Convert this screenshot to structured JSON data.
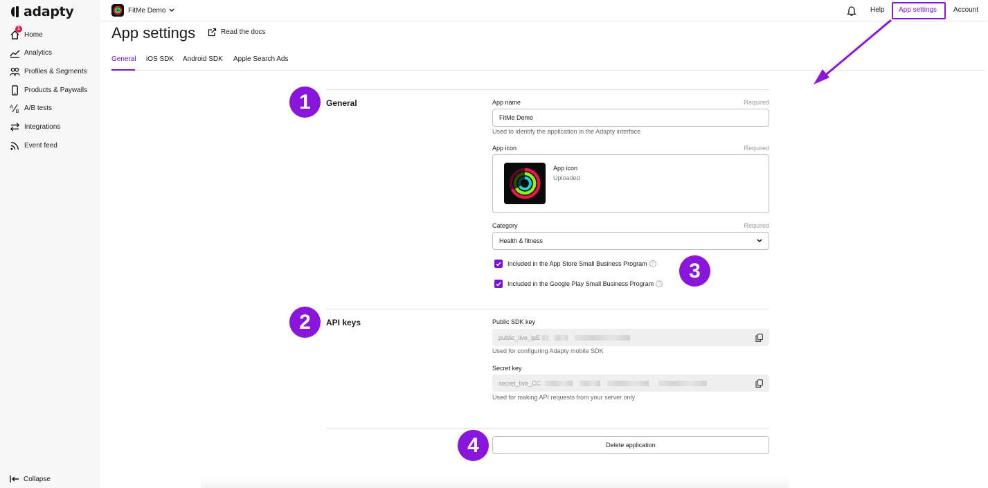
{
  "brand": {
    "name": "adapty",
    "accent": "#8a16dc"
  },
  "sidebar": {
    "items": [
      {
        "label": "Home",
        "icon": "home-icon",
        "badge": "1"
      },
      {
        "label": "Analytics",
        "icon": "chart-line-icon"
      },
      {
        "label": "Profiles & Segments",
        "icon": "users-icon"
      },
      {
        "label": "Products & Paywalls",
        "icon": "phone-icon"
      },
      {
        "label": "A/B tests",
        "icon": "ab-test-icon"
      },
      {
        "label": "Integrations",
        "icon": "arrows-exchange-icon"
      },
      {
        "label": "Event feed",
        "icon": "rss-icon"
      }
    ],
    "collapse_label": "Collapse"
  },
  "topbar": {
    "app_name": "FitMe Demo",
    "help": "Help",
    "app_settings": "App settings",
    "account": "Account"
  },
  "page": {
    "title": "App settings",
    "docs_link": "Read the docs",
    "tabs": [
      "General",
      "iOS SDK",
      "Android SDK",
      "Apple Search Ads"
    ],
    "active_tab": "General"
  },
  "general": {
    "step": "1",
    "title": "General",
    "app_name_label": "App name",
    "required": "Required",
    "app_name_value": "FitMe Demo",
    "app_name_hint": "Used to identify the application in the Adapty interface",
    "app_icon_label": "App icon",
    "app_icon_title": "App icon",
    "app_icon_status": "Uploaded",
    "category_label": "Category",
    "category_value": "Health & fitness",
    "checkbox_app_store": "Included in the App Store Small Business Program",
    "checkbox_google_play": "Included in the Google Play Small Business Program",
    "checkbox_step": "3"
  },
  "api_keys": {
    "step": "2",
    "title": "API keys",
    "public_label": "Public SDK key",
    "public_value": "public_live_lpE",
    "public_hint": "Used for configuring Adapty mobile SDK",
    "secret_label": "Secret key",
    "secret_value": "secret_live_CC",
    "secret_hint": "Used for making API requests from your server only"
  },
  "danger": {
    "step": "4",
    "delete_label": "Delete application"
  }
}
